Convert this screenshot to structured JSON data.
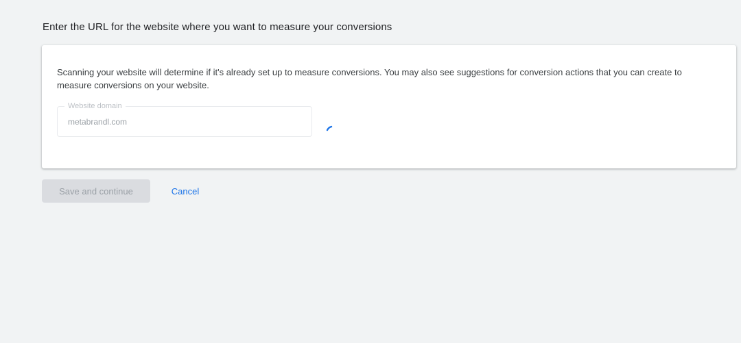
{
  "page": {
    "heading": "Enter the URL for the website where you want to measure your conversions"
  },
  "card": {
    "description": "Scanning your website will determine if it's already set up to measure conversions. You may also see suggestions for conversion actions that you can create to measure conversions on your website.",
    "domain_field": {
      "label": "Website domain",
      "value": "metabrandl.com"
    },
    "loading": true
  },
  "actions": {
    "save_label": "Save and continue",
    "save_disabled": true,
    "cancel_label": "Cancel"
  },
  "colors": {
    "background": "#f1f3f4",
    "card": "#ffffff",
    "link": "#1a73e8",
    "disabled_button": "#dadce0",
    "disabled_text": "#9aa0a6",
    "spinner": "#1a73e8"
  },
  "icons": {
    "spinner": "loading-spinner-icon"
  }
}
